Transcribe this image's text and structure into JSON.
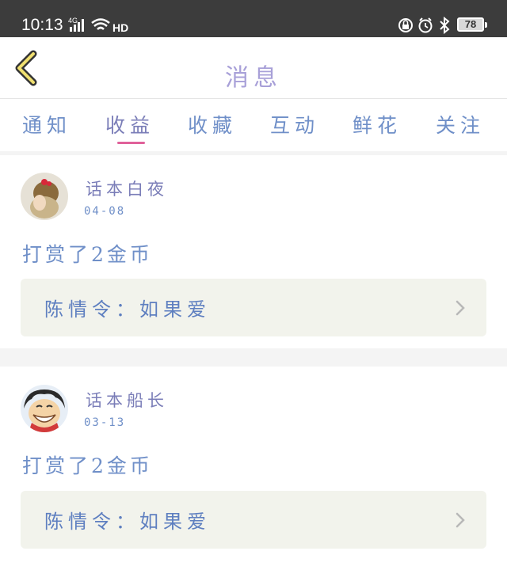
{
  "status_bar": {
    "time": "10:13",
    "network": "4G",
    "hd": "HD",
    "battery": "78"
  },
  "header": {
    "title": "消息"
  },
  "tabs": [
    {
      "label": "通知",
      "active": false
    },
    {
      "label": "收益",
      "active": true
    },
    {
      "label": "收藏",
      "active": false
    },
    {
      "label": "互动",
      "active": false
    },
    {
      "label": "鲜花",
      "active": false
    },
    {
      "label": "关注",
      "active": false
    }
  ],
  "messages": [
    {
      "username": "话本白夜",
      "date": "04-08",
      "action": "打赏了2金币",
      "reference": "陈情令：如果爱"
    },
    {
      "username": "话本船长",
      "date": "03-13",
      "action": "打赏了2金币",
      "reference": "陈情令：如果爱"
    }
  ],
  "colors": {
    "accent": "#e0619a",
    "text_blue": "#6f8fc8",
    "title": "#a8a0d8",
    "ref_bg": "#f2f3ec",
    "status_bar": "#3c3c3c"
  }
}
